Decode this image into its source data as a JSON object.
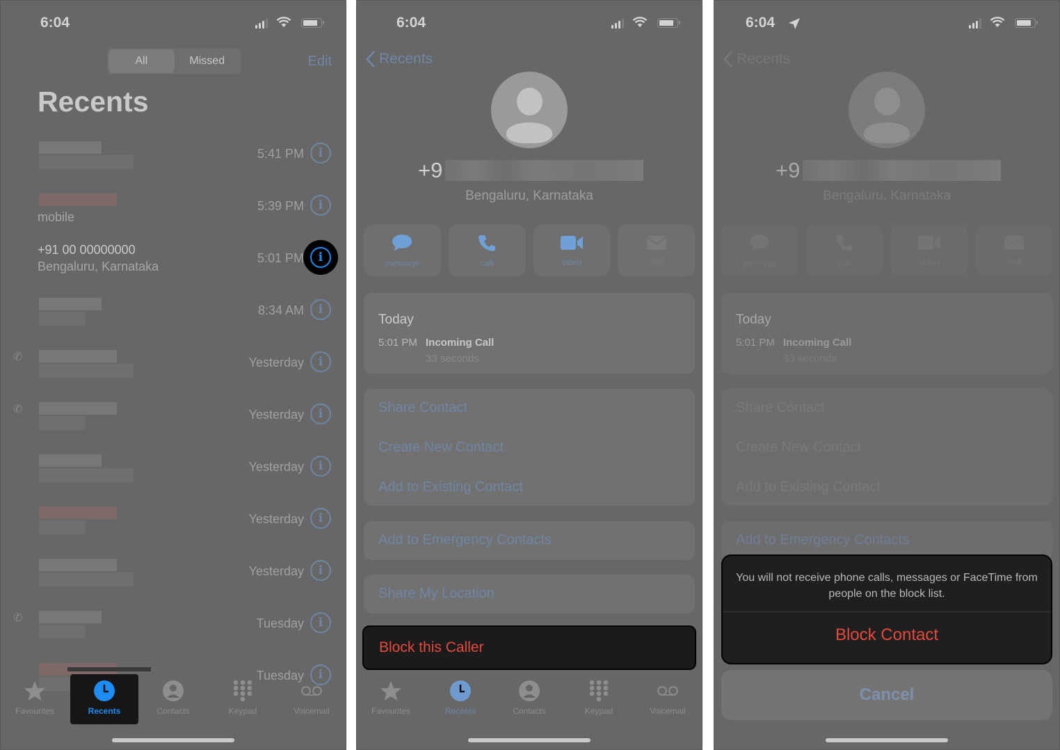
{
  "status_bar": {
    "time": "6:04"
  },
  "panel1": {
    "segments": [
      "All",
      "Missed"
    ],
    "active_segment": "All",
    "edit_label": "Edit",
    "title": "Recents",
    "rows": [
      {
        "name": "",
        "sub": "",
        "time": "5:41 PM",
        "redacted": true,
        "missed": false
      },
      {
        "name": "",
        "sub": "mobile",
        "time": "5:39 PM",
        "redacted": true,
        "missed": true
      },
      {
        "name": "+91 00 00000000",
        "sub": "Bengaluru, Karnataka",
        "time": "5:01 PM",
        "redacted": false,
        "highlighted": true
      },
      {
        "name": "",
        "sub": "",
        "time": "8:34 AM",
        "redacted": true
      },
      {
        "name": "",
        "sub": "",
        "time": "Yesterday",
        "redacted": true,
        "outgoing": true
      },
      {
        "name": "",
        "sub": "",
        "time": "Yesterday",
        "redacted": true,
        "outgoing": true
      },
      {
        "name": "",
        "sub": "",
        "time": "Yesterday",
        "redacted": true
      },
      {
        "name": "",
        "sub": "",
        "time": "Yesterday",
        "redacted": true,
        "missed": true
      },
      {
        "name": "",
        "sub": "",
        "time": "Yesterday",
        "redacted": true
      },
      {
        "name": "",
        "sub": "",
        "time": "Tuesday",
        "redacted": true,
        "outgoing": true
      },
      {
        "name": "",
        "sub": "",
        "time": "Tuesday",
        "redacted": true,
        "missed": true
      }
    ]
  },
  "tabbar": {
    "tabs": [
      {
        "label": "Favourites",
        "icon": "star-icon"
      },
      {
        "label": "Recents",
        "icon": "clock-icon"
      },
      {
        "label": "Contacts",
        "icon": "person-circle-icon"
      },
      {
        "label": "Keypad",
        "icon": "keypad-icon"
      },
      {
        "label": "Voicemail",
        "icon": "voicemail-icon"
      }
    ],
    "active": "Recents"
  },
  "detail": {
    "back_label": "Recents",
    "number_prefix": "+9",
    "location": "Bengaluru, Karnataka",
    "actions": [
      {
        "label": "message",
        "icon": "message-icon",
        "enabled": true
      },
      {
        "label": "call",
        "icon": "phone-icon",
        "enabled": true
      },
      {
        "label": "video",
        "icon": "video-icon",
        "enabled": true
      },
      {
        "label": "mail",
        "icon": "mail-icon",
        "enabled": false
      }
    ],
    "call_log": {
      "day": "Today",
      "time": "5:01 PM",
      "type": "Incoming Call",
      "duration": "33 seconds"
    },
    "contact_options": [
      "Share Contact",
      "Create New Contact",
      "Add to Existing Contact"
    ],
    "emergency_label": "Add to Emergency Contacts",
    "share_location_label": "Share My Location",
    "block_label": "Block this Caller"
  },
  "block_sheet": {
    "message": "You will not receive phone calls, messages or FaceTime from people on the block list.",
    "confirm_label": "Block Contact",
    "cancel_label": "Cancel"
  },
  "colors": {
    "accent_blue": "#1e8cf0",
    "destructive_red": "#e34a3e",
    "dim_overlay": "#676767"
  }
}
